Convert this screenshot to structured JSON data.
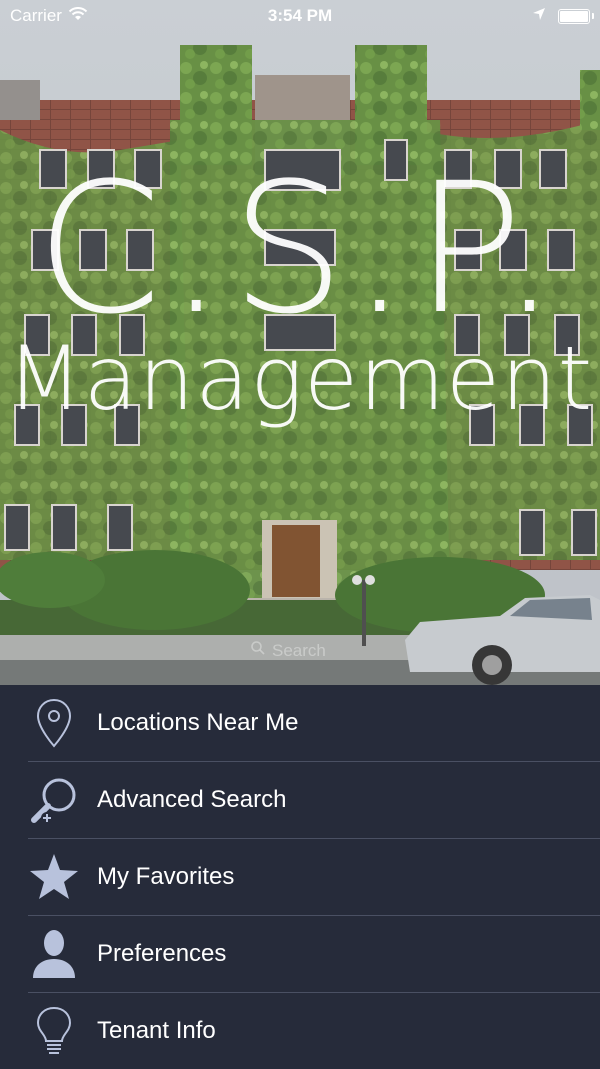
{
  "status_bar": {
    "carrier": "Carrier",
    "time": "3:54 PM",
    "icons": [
      "wifi-icon",
      "location-arrow-icon",
      "battery-icon"
    ]
  },
  "brand": {
    "line1": "C.S.P.",
    "line2": "Management"
  },
  "search": {
    "hint": "Search"
  },
  "menu": {
    "items": [
      {
        "label": "Locations Near Me",
        "icon": "location-pin-icon"
      },
      {
        "label": "Advanced Search",
        "icon": "magnifier-plus-icon"
      },
      {
        "label": "My Favorites",
        "icon": "star-icon"
      },
      {
        "label": "Preferences",
        "icon": "user-icon"
      },
      {
        "label": "Tenant Info",
        "icon": "lightbulb-icon"
      }
    ]
  },
  "colors": {
    "menu_bg": "#262b3a",
    "divider": "#4a5063",
    "icon": "#b8c2dc"
  }
}
